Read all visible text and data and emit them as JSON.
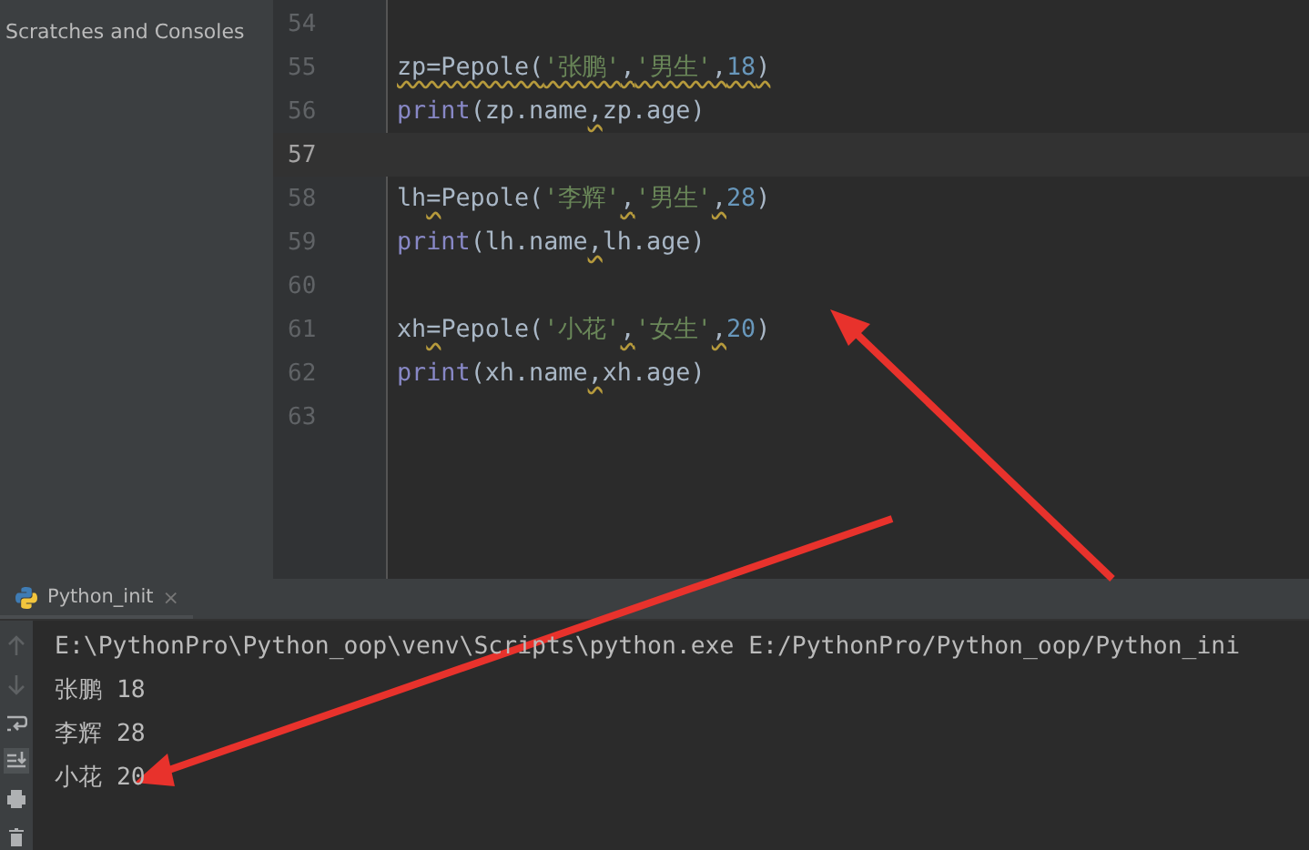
{
  "sidebar": {
    "items": [
      "Scratches and Consoles"
    ]
  },
  "editor": {
    "lines": [
      {
        "number": "54",
        "current": false
      },
      {
        "number": "55",
        "current": false,
        "tokens": [
          {
            "text": "zp=Pepole(",
            "kind": "name-warn"
          },
          {
            "text": "'张鹏'",
            "kind": "string-warn"
          },
          {
            "text": ",",
            "kind": "name-warn"
          },
          {
            "text": "'男生'",
            "kind": "string-warn"
          },
          {
            "text": ",",
            "kind": "name-warn"
          },
          {
            "text": "18",
            "kind": "number-warn"
          },
          {
            "text": ")",
            "kind": "name-warn"
          }
        ]
      },
      {
        "number": "56",
        "current": false,
        "tokens": [
          {
            "text": "print",
            "kind": "builtin"
          },
          {
            "text": "(",
            "kind": "name"
          },
          {
            "text": "zp.name",
            "kind": "name"
          },
          {
            "text": ",",
            "kind": "name-warn"
          },
          {
            "text": "zp.age",
            "kind": "name"
          },
          {
            "text": ")",
            "kind": "name"
          }
        ]
      },
      {
        "number": "57",
        "current": true
      },
      {
        "number": "58",
        "current": false,
        "tokens": [
          {
            "text": "lh",
            "kind": "name"
          },
          {
            "text": "=",
            "kind": "name-warn"
          },
          {
            "text": "Pepole(",
            "kind": "name"
          },
          {
            "text": "'李辉'",
            "kind": "string"
          },
          {
            "text": ",",
            "kind": "name-warn"
          },
          {
            "text": "'男生'",
            "kind": "string"
          },
          {
            "text": ",",
            "kind": "name-warn"
          },
          {
            "text": "28",
            "kind": "number"
          },
          {
            "text": ")",
            "kind": "name"
          }
        ]
      },
      {
        "number": "59",
        "current": false,
        "tokens": [
          {
            "text": "print",
            "kind": "builtin"
          },
          {
            "text": "(",
            "kind": "name"
          },
          {
            "text": "lh.name",
            "kind": "name"
          },
          {
            "text": ",",
            "kind": "name-warn"
          },
          {
            "text": "lh.age",
            "kind": "name"
          },
          {
            "text": ")",
            "kind": "name"
          }
        ]
      },
      {
        "number": "60",
        "current": false
      },
      {
        "number": "61",
        "current": false,
        "tokens": [
          {
            "text": "xh",
            "kind": "name"
          },
          {
            "text": "=",
            "kind": "name-warn"
          },
          {
            "text": "Pepole(",
            "kind": "name"
          },
          {
            "text": "'小花'",
            "kind": "string"
          },
          {
            "text": ",",
            "kind": "name-warn"
          },
          {
            "text": "'女生'",
            "kind": "string"
          },
          {
            "text": ",",
            "kind": "name-warn"
          },
          {
            "text": "20",
            "kind": "number"
          },
          {
            "text": ")",
            "kind": "name"
          }
        ]
      },
      {
        "number": "62",
        "current": false,
        "tokens": [
          {
            "text": "print",
            "kind": "builtin"
          },
          {
            "text": "(",
            "kind": "name"
          },
          {
            "text": "xh.name",
            "kind": "name"
          },
          {
            "text": ",",
            "kind": "name-warn"
          },
          {
            "text": "xh.age",
            "kind": "name"
          },
          {
            "text": ")",
            "kind": "name"
          }
        ]
      },
      {
        "number": "63",
        "current": false
      }
    ]
  },
  "run_panel": {
    "tab": {
      "label": "Python_init",
      "close": "×"
    },
    "toolbar": [
      {
        "kind": "up",
        "selected": false
      },
      {
        "kind": "down",
        "selected": false
      },
      {
        "kind": "wrap",
        "selected": false
      },
      {
        "kind": "scroll-end",
        "selected": true
      },
      {
        "kind": "print",
        "selected": false
      },
      {
        "kind": "trash",
        "selected": false
      }
    ],
    "output": [
      "E:\\PythonPro\\Python_oop\\venv\\Scripts\\python.exe E:/PythonPro/Python_oop/Python_ini",
      "张鹏 18",
      "李辉 28",
      "小花 20"
    ]
  }
}
